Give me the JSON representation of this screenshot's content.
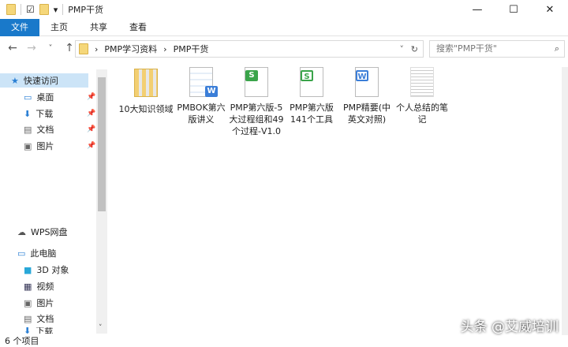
{
  "window": {
    "title": "PMP干货",
    "minimize": "—",
    "maximize": "☐",
    "close": "✕"
  },
  "ribbon": {
    "tabs": [
      "文件",
      "主页",
      "共享",
      "查看"
    ]
  },
  "address": {
    "back": "←",
    "forward": "→",
    "recent": "˅",
    "up": "↑",
    "path": [
      "PMP学习资料",
      "PMP干货"
    ],
    "refresh": "↻",
    "search_placeholder": "搜索\"PMP干货\"",
    "search_icon": "⌕"
  },
  "sidebar": {
    "items": [
      {
        "label": "快速访问",
        "icon": "star-icon"
      },
      {
        "label": "桌面",
        "icon": "desktop-icon",
        "pinned": true
      },
      {
        "label": "下载",
        "icon": "download-icon",
        "pinned": true
      },
      {
        "label": "文档",
        "icon": "document-icon",
        "pinned": true
      },
      {
        "label": "图片",
        "icon": "picture-icon",
        "pinned": true
      },
      {
        "label": "WPS网盘",
        "icon": "cloud-icon"
      },
      {
        "label": "此电脑",
        "icon": "computer-icon"
      },
      {
        "label": "3D 对象",
        "icon": "cube-icon"
      },
      {
        "label": "视频",
        "icon": "video-icon"
      },
      {
        "label": "图片",
        "icon": "picture-icon"
      },
      {
        "label": "文档",
        "icon": "document-icon"
      },
      {
        "label": "下载",
        "icon": "download-icon"
      }
    ]
  },
  "files": [
    {
      "name": "10大知识领域",
      "type": "folder"
    },
    {
      "name": "PMBOK第六版讲义",
      "type": "word-thumb"
    },
    {
      "name": "PMP第六版-5大过程组和49个过程-V1.0",
      "type": "sheet",
      "badge": "S",
      "color": "#3aa44a"
    },
    {
      "name": "PMP第六版141个工具",
      "type": "sheet",
      "badge": "S",
      "color": "#3aa44a"
    },
    {
      "name": "PMP精要(中英文对照)",
      "type": "word",
      "badge": "W",
      "color": "#3b7ed8"
    },
    {
      "name": "个人总结的笔记",
      "type": "thumb"
    }
  ],
  "status": {
    "count": "6 个项目"
  },
  "watermark": "头条 @艾威培训"
}
